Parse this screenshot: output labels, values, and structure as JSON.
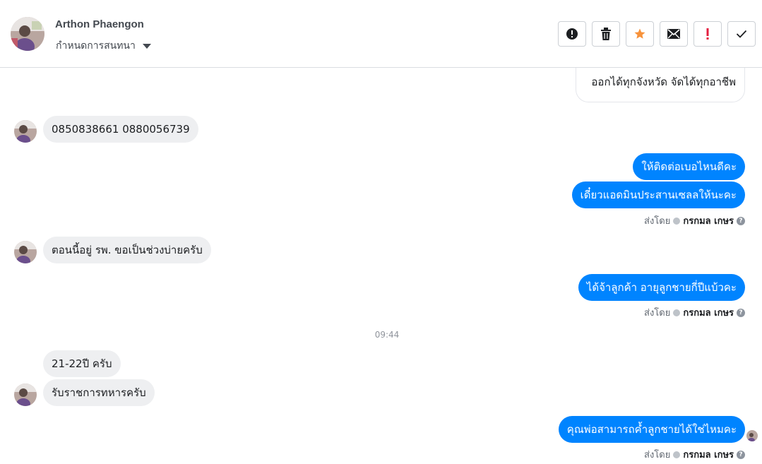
{
  "header": {
    "name": "Arthon Phaengon",
    "subtitle": "กำหนดการสนทนา"
  },
  "toolbar": {
    "buttons": [
      {
        "icon": "alert-circle-icon",
        "color": "#1c1e21"
      },
      {
        "icon": "trash-icon",
        "color": "#1c1e21"
      },
      {
        "icon": "star-icon",
        "color": "#f7923b"
      },
      {
        "icon": "envelope-icon",
        "color": "#1c1e21"
      },
      {
        "icon": "exclamation-icon",
        "color": "#e41e3f"
      },
      {
        "icon": "checkmark-icon",
        "color": "#1c1e21"
      }
    ]
  },
  "messages": {
    "m0": "ออกได้ทุกจังหวัด จัดได้ทุกอาชีพ",
    "m1": "0850838661 0880056739",
    "m2": "ให้ติดต่อเบอไหนดีคะ",
    "m3": "เดี๋ยวแอดมินประสานเซลลให้นะคะ",
    "m4": "ตอนนี้อยู่ รพ. ขอเป็นช่วงบ่ายครับ",
    "m5": "ได้จ้าลูกค้า อายุลูกชายกี่ปีแบ้วคะ",
    "m6": "21-22ปี ครับ",
    "m7": "รับราชการทหารครับ",
    "m8": "คุณพ่อสามารถค้ำลูกชายได้ใช่ไหมคะ"
  },
  "sent_by": {
    "prefix": "ส่งโดย",
    "agent": "กรกมล เกษร"
  },
  "timestamp": "09:44",
  "colors": {
    "outgoing": "#0084ff",
    "incoming": "#eeeff1"
  }
}
